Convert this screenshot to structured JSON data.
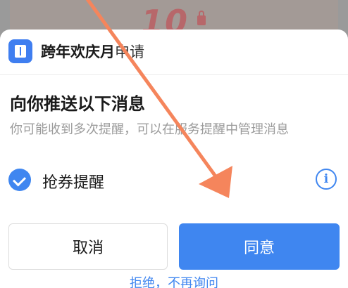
{
  "background": {
    "number_text": "10"
  },
  "dialog": {
    "app_name": "跨年欢庆月",
    "app_name_suffix": "申请",
    "heading": "向你推送以下消息",
    "description": "你可能收到多次提醒，可以在服务提醒中管理消息",
    "option": {
      "label": "抢券提醒",
      "checked": true,
      "check_icon": "check-circle-icon",
      "info_icon": "info-icon"
    },
    "buttons": {
      "cancel_label": "取消",
      "agree_label": "同意"
    },
    "reject_link": "拒绝，不再询问"
  },
  "colors": {
    "accent": "#3f86f0",
    "arrow": "#f5855c",
    "text_primary": "#1a1a1a",
    "text_secondary": "#9b9b9b"
  }
}
